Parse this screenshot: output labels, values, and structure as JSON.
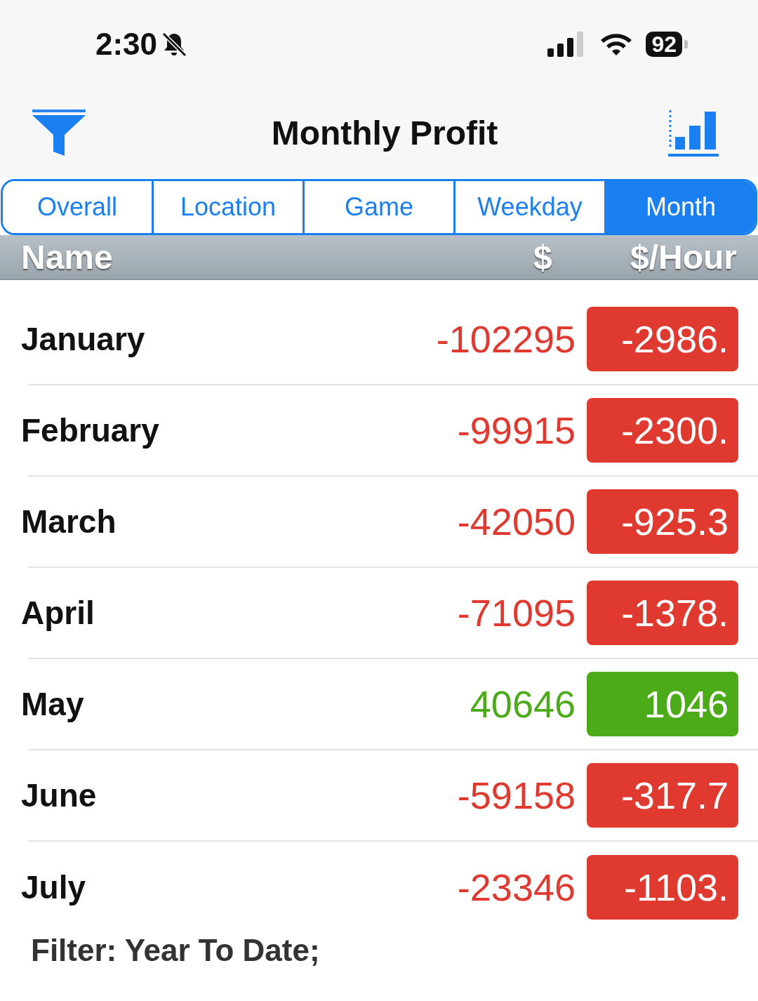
{
  "status_bar": {
    "time": "2:30",
    "battery": "92"
  },
  "nav": {
    "title": "Monthly Profit"
  },
  "tabs": [
    {
      "label": "Overall",
      "selected": false
    },
    {
      "label": "Location",
      "selected": false
    },
    {
      "label": "Game",
      "selected": false
    },
    {
      "label": "Weekday",
      "selected": false
    },
    {
      "label": "Month",
      "selected": true
    }
  ],
  "table": {
    "columns": [
      "Name",
      "$",
      "$/Hour"
    ],
    "rows": [
      {
        "name": "January",
        "amount": "-102295",
        "per_hour": "-2986.",
        "color": "#e0392f"
      },
      {
        "name": "February",
        "amount": "-99915",
        "per_hour": "-2300.",
        "color": "#e0392f"
      },
      {
        "name": "March",
        "amount": "-42050",
        "per_hour": "-925.3",
        "color": "#e0392f"
      },
      {
        "name": "April",
        "amount": "-71095",
        "per_hour": "-1378.",
        "color": "#e0392f"
      },
      {
        "name": "May",
        "amount": "40646",
        "per_hour": "1046",
        "color": "#4cab19"
      },
      {
        "name": "June",
        "amount": "-59158",
        "per_hour": "-317.7",
        "color": "#e0392f"
      },
      {
        "name": "July",
        "amount": "-23346",
        "per_hour": "-1103.",
        "color": "#e0392f"
      }
    ]
  },
  "footer": "Filter: Year To Date;"
}
